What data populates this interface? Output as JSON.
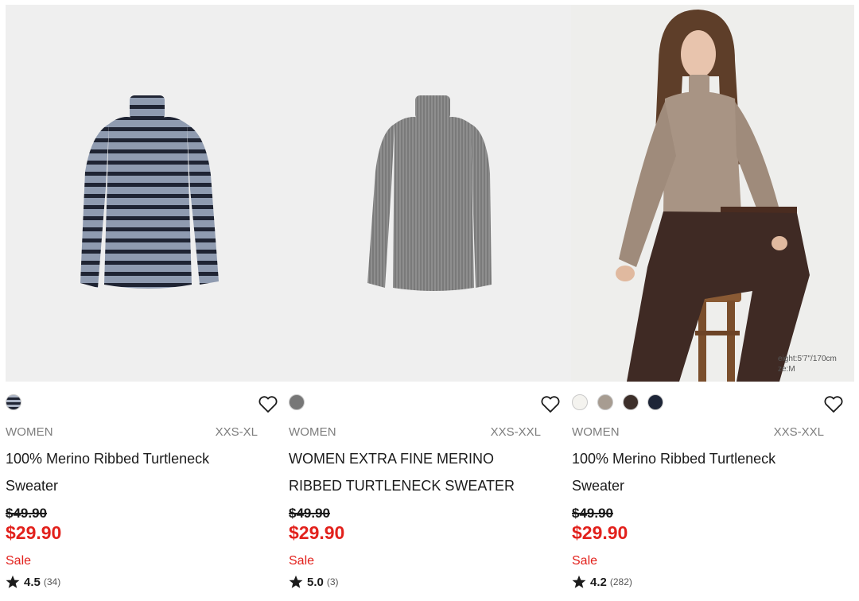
{
  "products": [
    {
      "gender": "WOMEN",
      "sizes": "XXS-XL",
      "name": "100% Merino Ribbed Turtleneck Sweater",
      "original_price": "$49.90",
      "sale_price": "$29.90",
      "flag": "Sale",
      "rating": "4.5",
      "review_count": "(34)",
      "image_icon": "striped-turtleneck-photo",
      "swatches": [
        "#5a6273"
      ]
    },
    {
      "gender": "WOMEN",
      "sizes": "XXS-XXL",
      "name": "WOMEN EXTRA FINE MERINO RIBBED TURTLENECK SWEATER",
      "original_price": "$49.90",
      "sale_price": "$29.90",
      "flag": "Sale",
      "rating": "5.0",
      "review_count": "(3)",
      "image_icon": "gray-turtleneck-photo",
      "swatches": [
        "#777777"
      ]
    },
    {
      "gender": "WOMEN",
      "sizes": "XXS-XXL",
      "name": "100% Merino Ribbed Turtleneck Sweater",
      "original_price": "$49.90",
      "sale_price": "$29.90",
      "flag": "Sale",
      "rating": "4.2",
      "review_count": "(282)",
      "image_icon": "model-wearing-turtleneck-photo",
      "image_caption": [
        "eight:5'7\"/170cm",
        "ze:M"
      ],
      "swatches": [
        "#f4f3ef",
        "#a79c91",
        "#3d2f2a",
        "#1d2537"
      ]
    }
  ],
  "colors": {
    "sale_red": "#e2211c",
    "muted_text": "#7d7d7d",
    "text": "#1b1b1b"
  }
}
